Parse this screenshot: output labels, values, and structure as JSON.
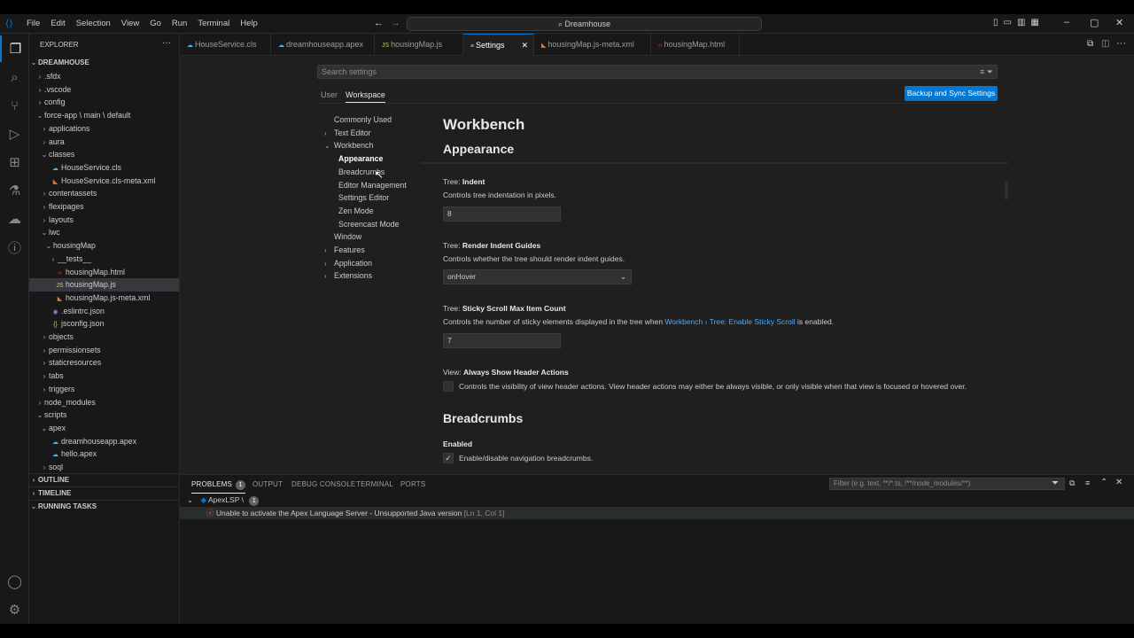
{
  "menu": [
    "File",
    "Edit",
    "Selection",
    "View",
    "Go",
    "Run",
    "Terminal",
    "Help"
  ],
  "command_center": "Dreamhouse",
  "explorer": {
    "header": "EXPLORER",
    "root": "DREAMHOUSE",
    "items": [
      {
        "label": ".sfdx",
        "indent": 1,
        "kind": "folder",
        "open": false
      },
      {
        "label": ".vscode",
        "indent": 1,
        "kind": "folder",
        "open": false
      },
      {
        "label": "config",
        "indent": 1,
        "kind": "folder",
        "open": false
      },
      {
        "label": "force-app \\ main \\ default",
        "indent": 1,
        "kind": "folder",
        "open": true
      },
      {
        "label": "applications",
        "indent": 2,
        "kind": "folder",
        "open": false
      },
      {
        "label": "aura",
        "indent": 2,
        "kind": "folder",
        "open": false
      },
      {
        "label": "classes",
        "indent": 2,
        "kind": "folder",
        "open": true
      },
      {
        "label": "HouseService.cls",
        "indent": 3,
        "kind": "apex"
      },
      {
        "label": "HouseService.cls-meta.xml",
        "indent": 3,
        "kind": "xml"
      },
      {
        "label": "contentassets",
        "indent": 2,
        "kind": "folder",
        "open": false
      },
      {
        "label": "flexipages",
        "indent": 2,
        "kind": "folder",
        "open": false
      },
      {
        "label": "layouts",
        "indent": 2,
        "kind": "folder",
        "open": false
      },
      {
        "label": "lwc",
        "indent": 2,
        "kind": "folder",
        "open": true
      },
      {
        "label": "housingMap",
        "indent": 3,
        "kind": "folder",
        "open": true
      },
      {
        "label": "__tests__",
        "indent": 4,
        "kind": "folder",
        "open": false
      },
      {
        "label": "housingMap.html",
        "indent": 4,
        "kind": "html"
      },
      {
        "label": "housingMap.js",
        "indent": 4,
        "kind": "js",
        "selected": true
      },
      {
        "label": "housingMap.js-meta.xml",
        "indent": 4,
        "kind": "xml"
      },
      {
        "label": ".eslintrc.json",
        "indent": 3,
        "kind": "eslint"
      },
      {
        "label": "jsconfig.json",
        "indent": 3,
        "kind": "json"
      },
      {
        "label": "objects",
        "indent": 2,
        "kind": "folder",
        "open": false
      },
      {
        "label": "permissionsets",
        "indent": 2,
        "kind": "folder",
        "open": false
      },
      {
        "label": "staticresources",
        "indent": 2,
        "kind": "folder",
        "open": false
      },
      {
        "label": "tabs",
        "indent": 2,
        "kind": "folder",
        "open": false
      },
      {
        "label": "triggers",
        "indent": 2,
        "kind": "folder",
        "open": false
      },
      {
        "label": "node_modules",
        "indent": 1,
        "kind": "folder",
        "open": false
      },
      {
        "label": "scripts",
        "indent": 1,
        "kind": "folder",
        "open": true
      },
      {
        "label": "apex",
        "indent": 2,
        "kind": "folder",
        "open": true
      },
      {
        "label": "dreamhouseapp.apex",
        "indent": 3,
        "kind": "apex"
      },
      {
        "label": "hello.apex",
        "indent": 3,
        "kind": "apex"
      },
      {
        "label": "soql",
        "indent": 2,
        "kind": "folder",
        "open": false
      }
    ],
    "sections": [
      "OUTLINE",
      "TIMELINE",
      "RUNNING TASKS"
    ]
  },
  "tabs": [
    {
      "label": "HouseService.cls",
      "kind": "apex"
    },
    {
      "label": "dreamhouseapp.apex",
      "kind": "apex"
    },
    {
      "label": "housingMap.js",
      "kind": "js"
    },
    {
      "label": "Settings",
      "kind": "settings",
      "active": true
    },
    {
      "label": "housingMap.js-meta.xml",
      "kind": "xml"
    },
    {
      "label": "housingMap.html",
      "kind": "html"
    }
  ],
  "settings": {
    "search_placeholder": "Search settings",
    "scope_tabs": [
      "User",
      "Workspace"
    ],
    "active_scope": "Workspace",
    "backup_button": "Backup and Sync Settings",
    "toc": [
      {
        "label": "Commonly Used",
        "level": 0,
        "chev": ""
      },
      {
        "label": "Text Editor",
        "level": 0,
        "chev": "right"
      },
      {
        "label": "Workbench",
        "level": 0,
        "chev": "down"
      },
      {
        "label": "Appearance",
        "level": 1,
        "selected": true
      },
      {
        "label": "Breadcrumbs",
        "level": 1
      },
      {
        "label": "Editor Management",
        "level": 1
      },
      {
        "label": "Settings Editor",
        "level": 1
      },
      {
        "label": "Zen Mode",
        "level": 1
      },
      {
        "label": "Screencast Mode",
        "level": 1
      },
      {
        "label": "Window",
        "level": 0,
        "chev": ""
      },
      {
        "label": "Features",
        "level": 0,
        "chev": "right"
      },
      {
        "label": "Application",
        "level": 0,
        "chev": "right"
      },
      {
        "label": "Extensions",
        "level": 0,
        "chev": "right"
      }
    ],
    "heading": "Workbench",
    "section_appearance": "Appearance",
    "section_breadcrumbs": "Breadcrumbs",
    "items": {
      "indent": {
        "prefix": "Tree: ",
        "name": "Indent",
        "desc": "Controls tree indentation in pixels.",
        "value": "8"
      },
      "guides": {
        "prefix": "Tree: ",
        "name": "Render Indent Guides",
        "desc": "Controls whether the tree should render indent guides.",
        "value": "onHover"
      },
      "sticky": {
        "prefix": "Tree: ",
        "name": "Sticky Scroll Max Item Count",
        "desc_before": "Controls the number of sticky elements displayed in the tree when ",
        "link": "Workbench › Tree: Enable Sticky Scroll",
        "desc_after": " is enabled.",
        "value": "7"
      },
      "header_actions": {
        "prefix": "View: ",
        "name": "Always Show Header Actions",
        "desc": "Controls the visibility of view header actions. View header actions may either be always visible, or only visible when that view is focused or hovered over."
      },
      "enabled": {
        "name": "Enabled",
        "desc": "Enable/disable navigation breadcrumbs."
      }
    }
  },
  "panel": {
    "tabs": [
      "PROBLEMS",
      "OUTPUT",
      "DEBUG CONSOLE",
      "TERMINAL",
      "PORTS"
    ],
    "problems_count": "1",
    "filter_placeholder": "Filter (e.g. text, **/*.ts, !**/node_modules/**)",
    "group": "ApexLSP \\",
    "group_count": "1",
    "error_message": "Unable to activate the Apex Language Server - Unsupported Java version",
    "error_location": "[Ln 1, Col 1]"
  },
  "colors": {
    "accent": "#0078d4",
    "error": "#f14c4c",
    "link": "#4daafc"
  }
}
